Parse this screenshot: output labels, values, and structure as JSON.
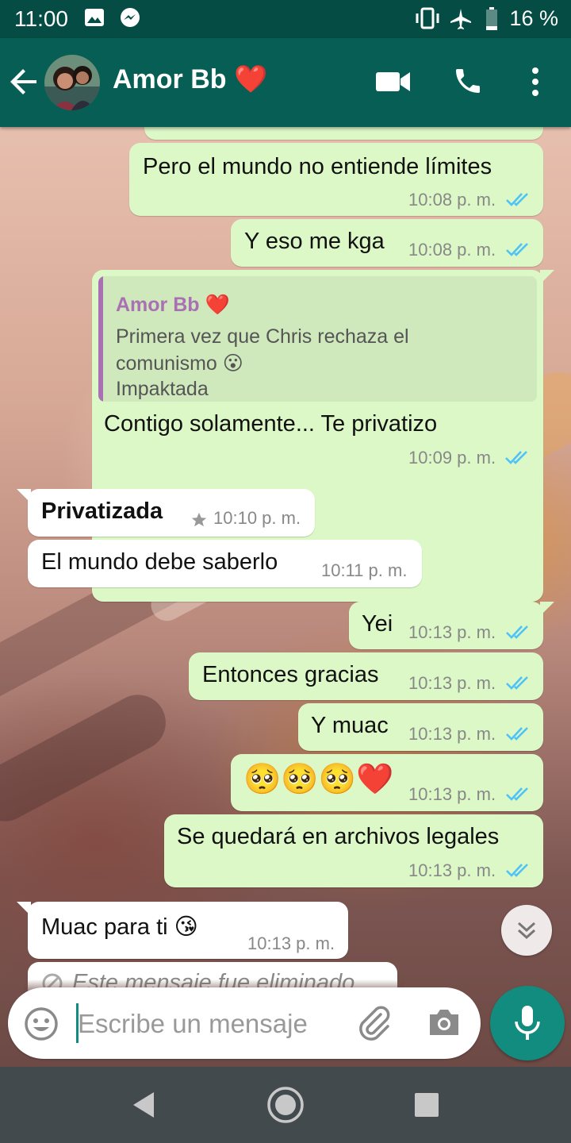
{
  "status_bar": {
    "time": "11:00",
    "battery": "16 %",
    "icons": [
      "gallery-icon",
      "messenger-icon",
      "vibrate-icon",
      "airplane-icon",
      "battery-icon"
    ]
  },
  "header": {
    "contact_name": "Amor Bb",
    "contact_emoji": "❤️",
    "actions": [
      "back-arrow-icon",
      "video-call-icon",
      "voice-call-icon",
      "more-options-icon"
    ]
  },
  "messages": [
    {
      "dir": "out",
      "text": "Pero el mundo no entiende límites",
      "time": "10:08 p. m.",
      "status": "read"
    },
    {
      "dir": "out",
      "text": "Y eso me kga",
      "time": "10:08 p. m.",
      "status": "read"
    },
    {
      "dir": "out",
      "reply_to": {
        "name": "Amor Bb ❤️",
        "line1": "Primera vez que Chris rechaza el",
        "line2": "comunismo 😮",
        "line3": "Impaktada"
      },
      "text": "Contigo solamente... Te privatizo",
      "time": "10:09 p. m.",
      "status": "read"
    },
    {
      "dir": "in",
      "text": "Privatizada",
      "time": "10:10 p. m.",
      "starred": true
    },
    {
      "dir": "in",
      "text": "El mundo debe saberlo",
      "time": "10:11 p. m."
    },
    {
      "dir": "out",
      "text": "Yei",
      "time": "10:13 p. m.",
      "status": "read"
    },
    {
      "dir": "out",
      "text": "Entonces gracias",
      "time": "10:13 p. m.",
      "status": "read"
    },
    {
      "dir": "out",
      "text": "Y muac",
      "time": "10:13 p. m.",
      "status": "read"
    },
    {
      "dir": "out",
      "text": "🥺🥺🥺❤️",
      "time": "10:13 p. m.",
      "status": "read"
    },
    {
      "dir": "out",
      "text": "Se quedará en archivos legales",
      "time": "10:13 p. m.",
      "status": "read"
    },
    {
      "dir": "in",
      "text": "Muac para ti 😘",
      "time": "10:13 p. m."
    },
    {
      "dir": "in",
      "text": "Este mensaje fue eliminado",
      "deleted": true
    }
  ],
  "composer": {
    "placeholder": "Escribe un mensaje"
  },
  "colors": {
    "header": "#075e54",
    "status_bar": "#054d44",
    "outgoing_bubble": "#dcf8c6",
    "incoming_bubble": "#ffffff",
    "read_ticks": "#4fc3f7",
    "mic_button": "#128c7e"
  }
}
